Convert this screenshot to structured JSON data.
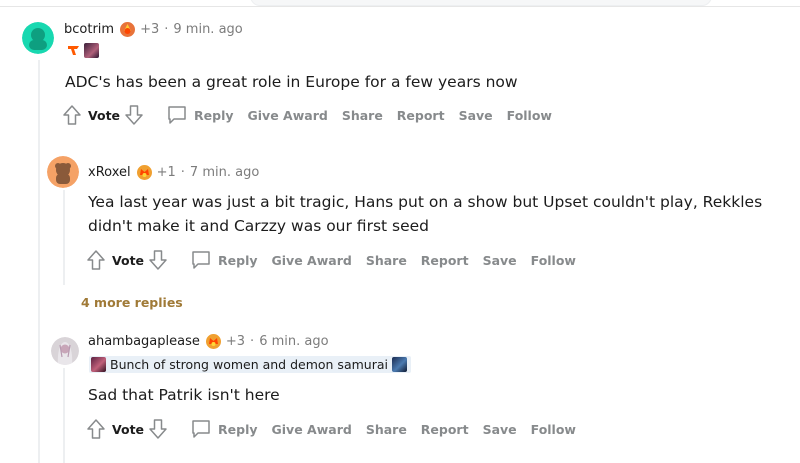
{
  "colors": {
    "text": "#1c1c1c",
    "meta": "#7c7c7c",
    "action": "#878a8c",
    "more_replies": "#a07a37",
    "thread_line": "#edeff1"
  },
  "actions": {
    "vote": "Vote",
    "reply": "Reply",
    "give_award": "Give Award",
    "share": "Share",
    "report": "Report",
    "save": "Save",
    "follow": "Follow"
  },
  "comments": [
    {
      "username": "bcotrim",
      "awards": "+3",
      "time": "9 min. ago",
      "flair_icons": [
        "fnatic-logo-icon",
        "champion-portrait-icon"
      ],
      "flair_text": "",
      "body": "ADC's has been a great role in Europe for a few years now"
    },
    {
      "username": "xRoxel",
      "awards": "+1",
      "time": "7 min. ago",
      "body_lines": [
        "Yea last year was just a bit tragic, Hans put on a show but Upset couldn't play, Rekkles",
        "didn't make it and Carzzy was our first seed"
      ]
    },
    {
      "username": "ahambagaplease",
      "awards": "+3",
      "time": "6 min. ago",
      "flair_text": "Bunch of strong women and demon samurai",
      "body": "Sad that Patrik isn't here"
    }
  ],
  "more_replies": "4 more replies",
  "separator": "·"
}
